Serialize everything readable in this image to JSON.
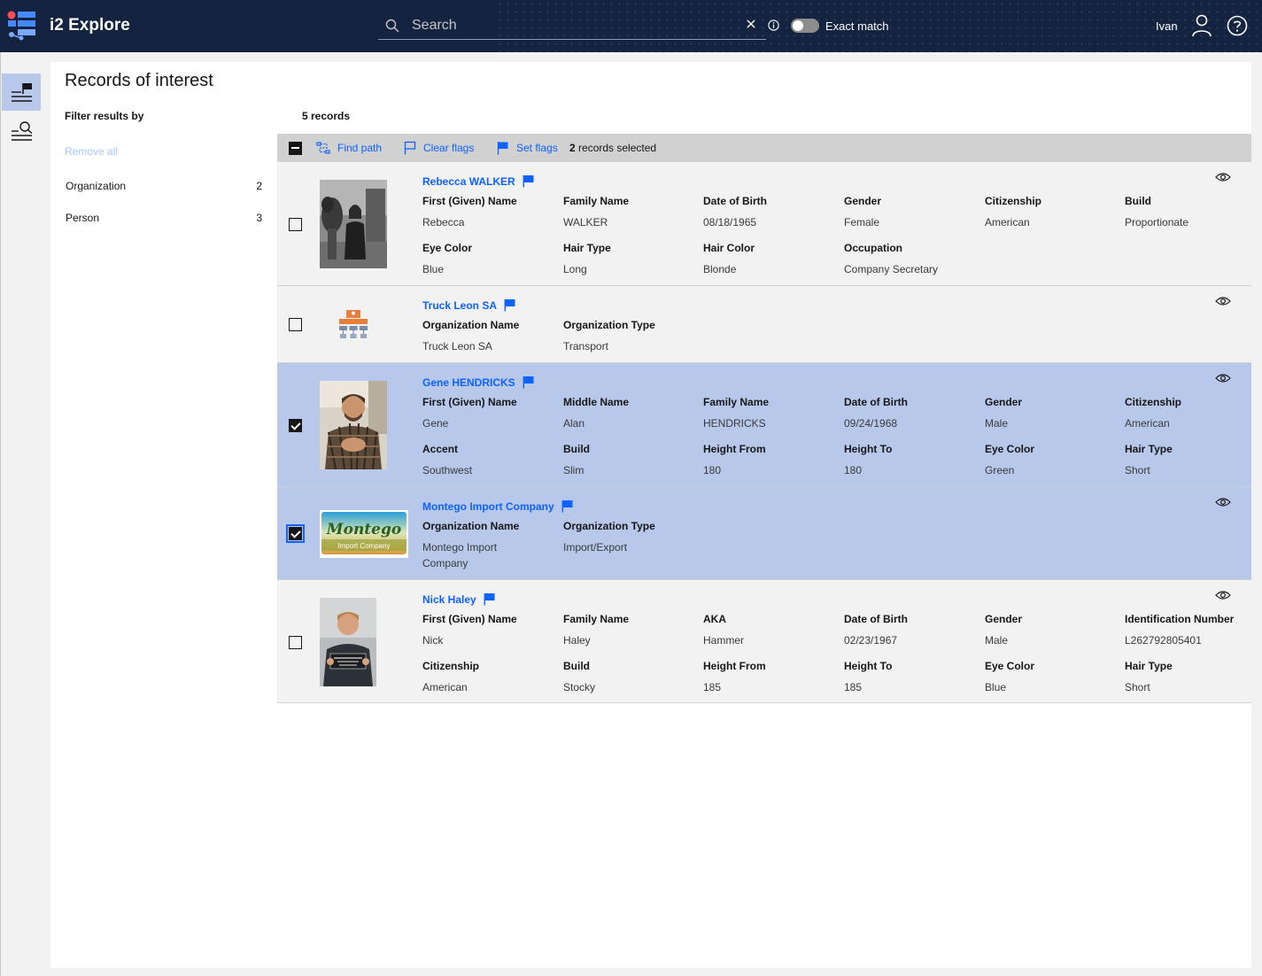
{
  "app": {
    "title": "i2 Explore"
  },
  "header": {
    "search_placeholder": "Search",
    "exact_match_label": "Exact match",
    "user_name": "Ivan"
  },
  "page": {
    "title": "Records of interest",
    "filter_title": "Filter results by",
    "remove_all": "Remove all",
    "facets": [
      {
        "label": "Organization",
        "count": "2"
      },
      {
        "label": "Person",
        "count": "3"
      }
    ],
    "records_count": "5 records"
  },
  "toolbar": {
    "find_path": "Find path",
    "clear_flags": "Clear flags",
    "set_flags": "Set flags",
    "selected_num": "2",
    "selected_suffix": " records selected"
  },
  "records": [
    {
      "title": "Rebecca WALKER",
      "fields": [
        {
          "label": "First (Given) Name",
          "value": "Rebecca"
        },
        {
          "label": "Family Name",
          "value": "WALKER"
        },
        {
          "label": "Date of Birth",
          "value": "08/18/1965"
        },
        {
          "label": "Gender",
          "value": "Female"
        },
        {
          "label": "Citizenship",
          "value": "American"
        },
        {
          "label": "Build",
          "value": "Proportionate"
        },
        {
          "label": "Eye Color",
          "value": "Blue"
        },
        {
          "label": "Hair Type",
          "value": "Long"
        },
        {
          "label": "Hair Color",
          "value": "Blonde"
        },
        {
          "label": "Occupation",
          "value": "Company Secretary"
        }
      ]
    },
    {
      "title": "Truck Leon SA",
      "fields": [
        {
          "label": "Organization Name",
          "value": "Truck Leon SA"
        },
        {
          "label": "Organization Type",
          "value": "Transport"
        }
      ]
    },
    {
      "title": "Gene HENDRICKS",
      "fields": [
        {
          "label": "First (Given) Name",
          "value": "Gene"
        },
        {
          "label": "Middle Name",
          "value": "Alan"
        },
        {
          "label": "Family Name",
          "value": "HENDRICKS"
        },
        {
          "label": "Date of Birth",
          "value": "09/24/1968"
        },
        {
          "label": "Gender",
          "value": "Male"
        },
        {
          "label": "Citizenship",
          "value": "American"
        },
        {
          "label": "Accent",
          "value": "Southwest"
        },
        {
          "label": "Build",
          "value": "Slim"
        },
        {
          "label": "Height From",
          "value": "180"
        },
        {
          "label": "Height To",
          "value": "180"
        },
        {
          "label": "Eye Color",
          "value": "Green"
        },
        {
          "label": "Hair Type",
          "value": "Short"
        }
      ]
    },
    {
      "title": "Montego Import Company",
      "logo_text": "Montego",
      "logo_sub": "Import Company",
      "fields": [
        {
          "label": "Organization Name",
          "value": "Montego Import Company"
        },
        {
          "label": "Organization Type",
          "value": "Import/Export"
        }
      ]
    },
    {
      "title": "Nick Haley",
      "fields": [
        {
          "label": "First (Given) Name",
          "value": "Nick"
        },
        {
          "label": "Family Name",
          "value": "Haley"
        },
        {
          "label": "AKA",
          "value": "Hammer"
        },
        {
          "label": "Date of Birth",
          "value": "02/23/1967"
        },
        {
          "label": "Gender",
          "value": "Male"
        },
        {
          "label": "Identification Number",
          "value": "L262792805401"
        },
        {
          "label": "Citizenship",
          "value": "American"
        },
        {
          "label": "Build",
          "value": "Stocky"
        },
        {
          "label": "Height From",
          "value": "185"
        },
        {
          "label": "Height To",
          "value": "185"
        },
        {
          "label": "Eye Color",
          "value": "Blue"
        },
        {
          "label": "Hair Type",
          "value": "Short"
        }
      ]
    }
  ],
  "colors": {
    "header_bg": "#14233f",
    "link": "#0f62fe",
    "selected_row": "#b7c8ea",
    "row_bg": "#f2f2f2"
  }
}
